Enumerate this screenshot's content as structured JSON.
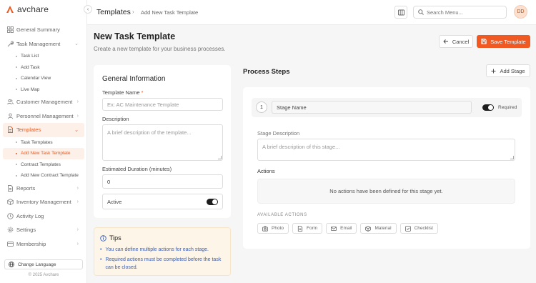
{
  "app": {
    "brand": "avchare",
    "copyright": "© 2025 Avchare",
    "change_language": "Change Language"
  },
  "colors": {
    "accent": "#f05a22",
    "active_bg": "#fdf0e8",
    "tips_bg": "#fdf6e8",
    "tip_text": "#3a5db3"
  },
  "sidebar": {
    "items": [
      {
        "label": "General Summary",
        "icon": "grid-icon"
      },
      {
        "label": "Task Management",
        "icon": "wrench-icon"
      },
      {
        "label": "Customer Management",
        "icon": "users-icon"
      },
      {
        "label": "Personnel Management",
        "icon": "user-group-icon"
      },
      {
        "label": "Templates",
        "icon": "document-icon"
      },
      {
        "label": "Reports",
        "icon": "document-icon"
      },
      {
        "label": "Inventory Management",
        "icon": "box-icon"
      },
      {
        "label": "Activity Log",
        "icon": "clock-icon"
      },
      {
        "label": "Settings",
        "icon": "gear-icon"
      },
      {
        "label": "Membership",
        "icon": "card-icon"
      }
    ],
    "task_sub": [
      "Task List",
      "Add Task",
      "Calendar View",
      "Live Map"
    ],
    "template_sub": [
      "Task Templates",
      "Add New Task Template",
      "Contract Templates",
      "Add New Contract Template"
    ]
  },
  "header": {
    "breadcrumb_root": "Templates",
    "breadcrumb_sep": "›",
    "breadcrumb_current": "Add New Task Template",
    "search_placeholder": "Search Menu...",
    "avatar_initials": "DD"
  },
  "page": {
    "title": "New Task Template",
    "subtitle": "Create a new template for your business processes.",
    "cancel_label": "Cancel",
    "save_label": "Save Template"
  },
  "general": {
    "title": "General Information",
    "name_label": "Template Name",
    "required_mark": "*",
    "name_placeholder": "Ex: AC Maintenance Template",
    "description_label": "Description",
    "description_placeholder": "A brief description of the template...",
    "duration_label": "Estimated Duration (minutes)",
    "duration_value": "0",
    "active_label": "Active",
    "active_on": true
  },
  "tips": {
    "title": "Tips",
    "items": [
      "You can define multiple actions for each stage.",
      "Required actions must be completed before the task can be closed."
    ]
  },
  "process": {
    "title": "Process Steps",
    "add_stage_label": "Add Stage",
    "stage_number": "1",
    "stage_name_placeholder": "Stage Name",
    "required_label": "Required",
    "required_on": true,
    "stage_description_label": "Stage Description",
    "stage_description_placeholder": "A brief description of this stage...",
    "actions_label": "Actions",
    "no_actions_text": "No actions have been defined for this stage yet.",
    "available_actions_label": "AVAILABLE ACTIONS",
    "available_actions": [
      {
        "label": "Photo",
        "icon": "camera-icon"
      },
      {
        "label": "Form",
        "icon": "form-icon"
      },
      {
        "label": "Email",
        "icon": "mail-icon"
      },
      {
        "label": "Material",
        "icon": "box-icon"
      },
      {
        "label": "Checklist",
        "icon": "checkbox-icon"
      }
    ]
  }
}
